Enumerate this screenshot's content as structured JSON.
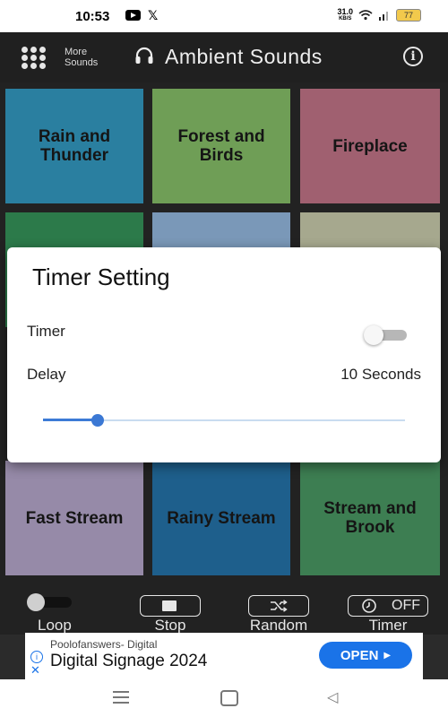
{
  "status": {
    "time": "10:53",
    "net_speed_top": "31.0",
    "net_speed_bottom": "KB/S",
    "battery": "77"
  },
  "header": {
    "more_sounds_line1": "More",
    "more_sounds_line2": "Sounds",
    "title": "Ambient Sounds"
  },
  "tiles": [
    {
      "label": "Rain and Thunder",
      "line1": "Rain and",
      "line2": "Thunder",
      "color": "#2a7fa0"
    },
    {
      "label": "Forest and Birds",
      "line1": "Forest and",
      "line2": "Birds",
      "color": "#6f9e56"
    },
    {
      "label": "Fireplace",
      "line1": "Fireplace",
      "line2": "",
      "color": "#a06070"
    },
    {
      "label": "",
      "line1": "",
      "line2": "",
      "color": "#2c7a4a"
    },
    {
      "label": "",
      "line1": "",
      "line2": "",
      "color": "#7a98b8"
    },
    {
      "label": "",
      "line1": "",
      "line2": "",
      "color": "#a6a88e"
    },
    {
      "label": "Fast Stream",
      "line1": "Fast Stream",
      "line2": "",
      "color": "#968aa8"
    },
    {
      "label": "Rainy Stream",
      "line1": "Rainy Stream",
      "line2": "",
      "color": "#1e5f8c"
    },
    {
      "label": "Stream and Brook",
      "line1": "Stream and",
      "line2": "Brook",
      "color": "#3d7e52"
    }
  ],
  "dialog": {
    "title": "Timer Setting",
    "timer_label": "Timer",
    "timer_on": false,
    "delay_label": "Delay",
    "delay_value": "10 Seconds",
    "delay_slider_fraction": 0.15
  },
  "controls": {
    "loop": "Loop",
    "stop": "Stop",
    "random": "Random",
    "timer": "Timer",
    "timer_state": "OFF"
  },
  "ad": {
    "sponsor": "Poolofanswers- Digital",
    "headline": "Digital Signage 2024",
    "cta": "OPEN"
  },
  "colors": {
    "accent": "#3b78d4",
    "ad_button": "#1a73e8"
  }
}
